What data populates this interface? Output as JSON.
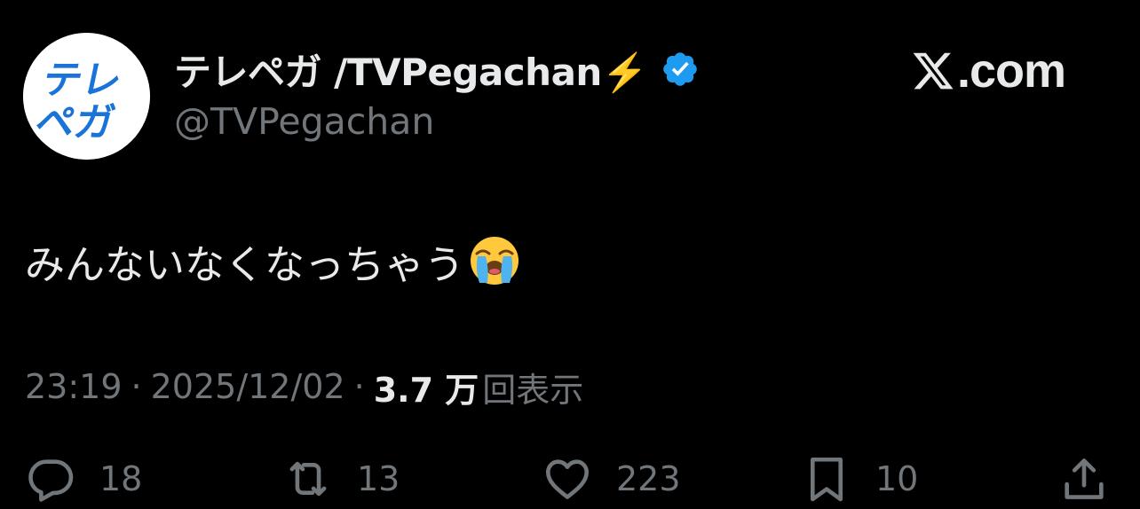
{
  "author": {
    "display_name": "テレペガ /TVPegachan⚡️",
    "handle": "@TVPegachan",
    "avatar_text_line1": "テレ",
    "avatar_text_line2": "ペガ"
  },
  "brand": {
    "text": ".com",
    "icon": "x-logo-icon"
  },
  "tweet": {
    "text": "みんないなくなっちゃう",
    "emoji": "loudly-crying-face-icon"
  },
  "meta": {
    "time": "23:19",
    "separator": "·",
    "date": "2025/12/02",
    "views_count": "3.7 万",
    "views_label": "回表示"
  },
  "actions": {
    "reply_count": "18",
    "repost_count": "13",
    "like_count": "223",
    "bookmark_count": "10"
  },
  "colors": {
    "background": "#000000",
    "primary_text": "#e7e9ea",
    "secondary_text": "#71767b",
    "verified_blue": "#1d9bf0",
    "avatar_blue": "#1a73d9"
  }
}
